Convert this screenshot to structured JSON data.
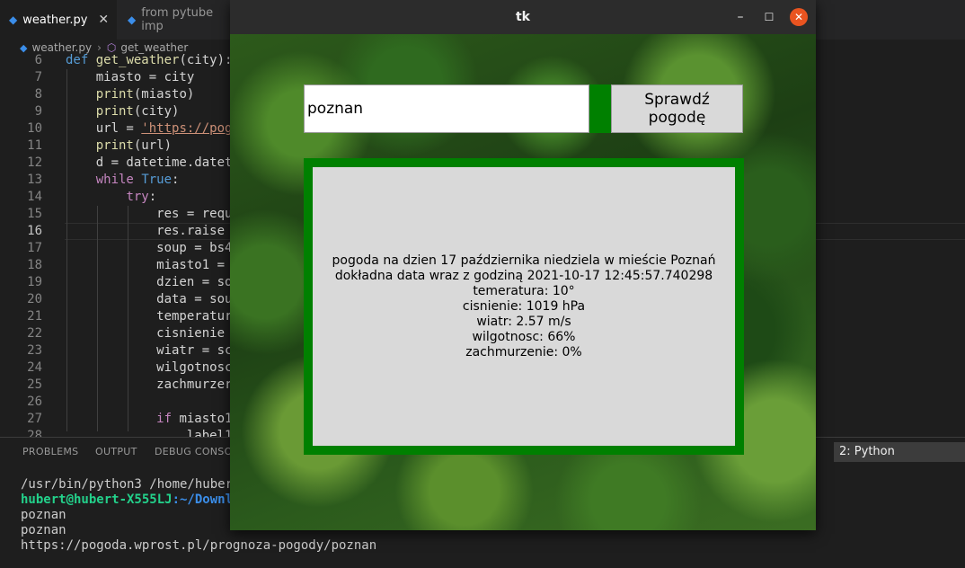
{
  "editor": {
    "tabs": [
      {
        "label": "weather.py",
        "active": true,
        "close": "✕"
      },
      {
        "label": "from pytube imp",
        "active": false
      }
    ],
    "breadcrumb": {
      "file": "weather.py",
      "symbol": "get_weather"
    },
    "code_lines": [
      {
        "num": "6",
        "text": "def get_weather(city):"
      },
      {
        "num": "7",
        "text": "    miasto = city"
      },
      {
        "num": "8",
        "text": "    print(miasto)"
      },
      {
        "num": "9",
        "text": "    print(city)"
      },
      {
        "num": "10",
        "text": "    url = 'https://pog"
      },
      {
        "num": "11",
        "text": "    print(url)"
      },
      {
        "num": "12",
        "text": "    d = datetime.datet"
      },
      {
        "num": "13",
        "text": "    while True:"
      },
      {
        "num": "14",
        "text": "        try:"
      },
      {
        "num": "15",
        "text": "            res = requ"
      },
      {
        "num": "16",
        "text": "            res.raise"
      },
      {
        "num": "17",
        "text": "            soup = bs4"
      },
      {
        "num": "18",
        "text": "            miasto1 ="
      },
      {
        "num": "19",
        "text": "            dzien = so"
      },
      {
        "num": "20",
        "text": "            data = sou"
      },
      {
        "num": "21",
        "text": "            temperatur"
      },
      {
        "num": "22",
        "text": "            cisnienie"
      },
      {
        "num": "23",
        "text": "            wiatr = sc"
      },
      {
        "num": "24",
        "text": "            wilgotnosc"
      },
      {
        "num": "25",
        "text": "            zachmurzer"
      },
      {
        "num": "26",
        "text": ""
      },
      {
        "num": "27",
        "text": "            if miasto1"
      },
      {
        "num": "28",
        "text": "                label1"
      }
    ],
    "current_line": "16"
  },
  "panel": {
    "tabs": [
      "PROBLEMS",
      "OUTPUT",
      "DEBUG CONSOL"
    ],
    "shell_selector": "2: Python",
    "terminal": {
      "cmd": "/usr/bin/python3 /home/hubert",
      "prompt_user": "hubert@hubert-X555LJ",
      "prompt_path": ":~/Downlo",
      "lines": [
        "poznan",
        "poznan",
        "https://pogoda.wprost.pl/prognoza-pogody/poznan"
      ]
    }
  },
  "tk": {
    "title": "tk",
    "minimize": "–",
    "maximize": "☐",
    "close": "✕",
    "city_value": "poznan",
    "button_label": "Sprawdź pogodę",
    "result_lines": [
      "pogoda na dzien 17 października niedziela w mieście Poznań",
      "dokładna data wraz z godziną 2021-10-17 12:45:57.740298",
      "temeratura: 10°",
      "cisnienie: 1019 hPa",
      "wiatr: 2.57 m/s",
      "wilgotnosc: 66%",
      "zachmurzenie: 0%"
    ],
    "accent_color": "#008000"
  }
}
